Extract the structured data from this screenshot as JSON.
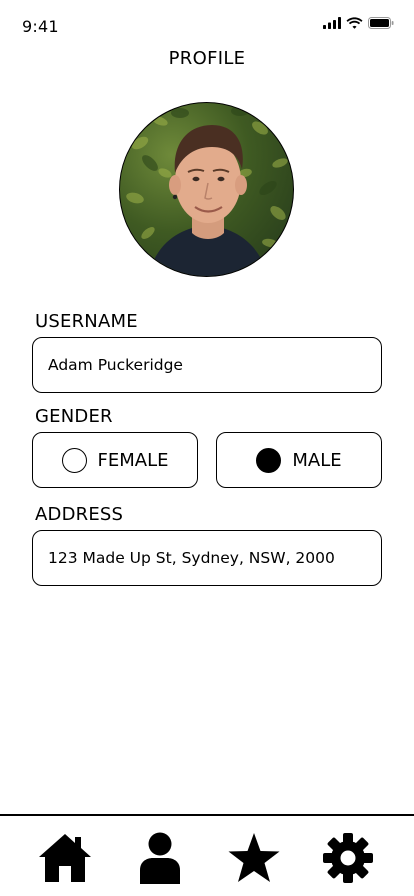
{
  "status_bar": {
    "time": "9:41",
    "icons": [
      "cellular-signal-icon",
      "wifi-icon",
      "battery-icon"
    ]
  },
  "header": {
    "title": "PROFILE"
  },
  "profile": {
    "avatar_icon": "profile-photo"
  },
  "form": {
    "username": {
      "label": "USERNAME",
      "value": "Adam Puckeridge"
    },
    "gender": {
      "label": "GENDER",
      "options": [
        {
          "label": "FEMALE",
          "selected": false
        },
        {
          "label": "MALE",
          "selected": true
        }
      ]
    },
    "address": {
      "label": "ADDRESS",
      "value": "123 Made Up St, Sydney, NSW, 2000"
    }
  },
  "tab_bar": {
    "items": [
      {
        "icon": "home-icon"
      },
      {
        "icon": "user-icon",
        "active": true
      },
      {
        "icon": "star-icon"
      },
      {
        "icon": "gear-icon"
      }
    ]
  },
  "colors": {
    "foreground": "#000000",
    "background": "#ffffff"
  }
}
